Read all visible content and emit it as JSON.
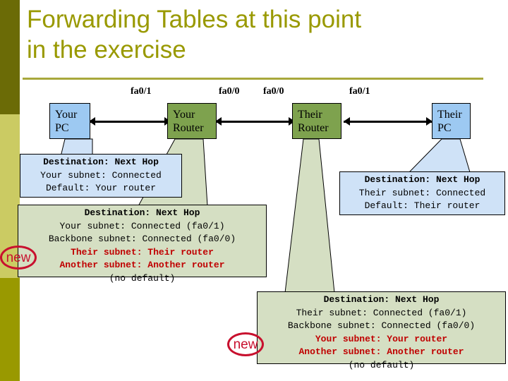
{
  "slide": {
    "title": "Forwarding Tables at this point\nin the exercise",
    "accent_color": "#999900",
    "rule_color": "#a8a83c"
  },
  "sidebar": {
    "top_color": "#6b6b06",
    "mid_color": "#cbcb63",
    "bottom_color": "#999900"
  },
  "diagram": {
    "interfaces": [
      {
        "label": "fa0/1"
      },
      {
        "label": "fa0/0"
      },
      {
        "label": "fa0/0"
      },
      {
        "label": "fa0/1"
      }
    ],
    "devices": [
      {
        "line1": "Your",
        "line2": "PC",
        "kind": "pc",
        "color": "#9dc9f2"
      },
      {
        "line1": "Your",
        "line2": "Router",
        "kind": "router",
        "color": "#7ea24e"
      },
      {
        "line1": "Their",
        "line2": "Router",
        "kind": "router",
        "color": "#7ea24e"
      },
      {
        "line1": "Their",
        "line2": "PC",
        "kind": "pc",
        "color": "#9dc9f2"
      }
    ]
  },
  "tables": {
    "your_pc": {
      "background": "#cfe2f7",
      "header": "Destination: Next Hop",
      "rows": [
        "Your subnet: Connected",
        "Default: Your router"
      ]
    },
    "your_router": {
      "background": "#d5dfc3",
      "header": "Destination: Next Hop",
      "rows": [
        "Your subnet: Connected (fa0/1)",
        "Backbone subnet: Connected (fa0/0)"
      ],
      "new_rows": [
        "Their subnet: Their router",
        "Another subnet: Another router"
      ],
      "footer": "(no default)",
      "badge": "new"
    },
    "their_pc": {
      "background": "#cfe2f7",
      "header": "Destination: Next Hop",
      "rows": [
        "Their subnet: Connected",
        "Default: Their router"
      ]
    },
    "their_router": {
      "background": "#d5dfc3",
      "header": "Destination: Next Hop",
      "rows": [
        "Their subnet: Connected (fa0/1)",
        "Backbone subnet: Connected (fa0/0)"
      ],
      "new_rows": [
        "Your subnet: Your router",
        "Another subnet: Another router"
      ],
      "footer": "(no default)",
      "badge": "new"
    }
  }
}
